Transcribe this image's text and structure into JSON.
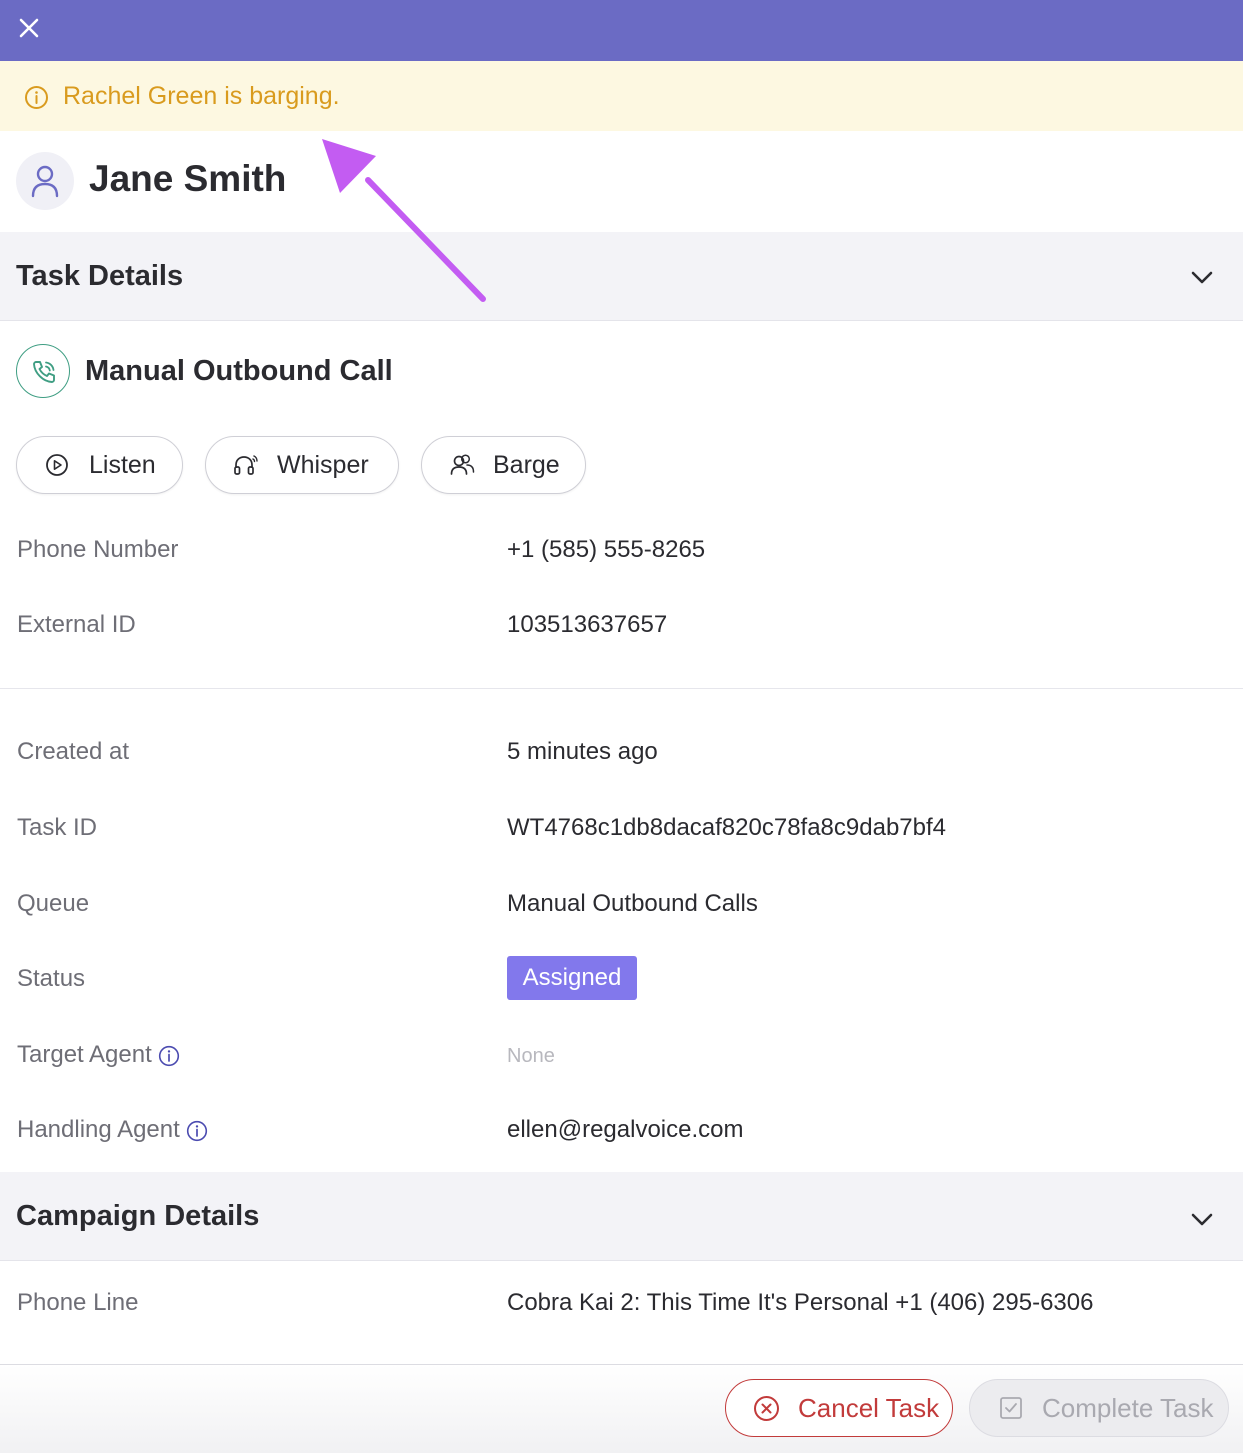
{
  "banner": {
    "text": "Rachel Green is barging."
  },
  "contact": {
    "name": "Jane Smith"
  },
  "task_details": {
    "title": "Task Details",
    "task_type": "Manual Outbound Call",
    "actions": {
      "listen": "Listen",
      "whisper": "Whisper",
      "barge": "Barge"
    },
    "fields": {
      "phone_number": {
        "label": "Phone Number",
        "value": "+1 (585) 555-8265"
      },
      "external_id": {
        "label": "External ID",
        "value": "103513637657"
      },
      "created_at": {
        "label": "Created at",
        "value": "5 minutes ago"
      },
      "task_id": {
        "label": "Task ID",
        "value": "WT4768c1db8dacaf820c78fa8c9dab7bf4"
      },
      "queue": {
        "label": "Queue",
        "value": "Manual Outbound Calls"
      },
      "status": {
        "label": "Status",
        "value": "Assigned"
      },
      "target_agent": {
        "label": "Target Agent",
        "value": "None"
      },
      "handling_agent": {
        "label": "Handling Agent",
        "value": "ellen@regalvoice.com"
      }
    }
  },
  "campaign_details": {
    "title": "Campaign Details",
    "phone_line": {
      "label": "Phone Line",
      "value": "Cobra Kai 2: This Time It's Personal +1 (406) 295-6306"
    }
  },
  "footer": {
    "cancel_label": "Cancel Task",
    "complete_label": "Complete Task"
  },
  "colors": {
    "topbar": "#6b6bc4",
    "banner_bg": "#fdf8e1",
    "banner_text": "#d99b1e",
    "status_badge": "#8278ec",
    "cancel": "#c23b3b",
    "annotation_arrow": "#c35cf2"
  },
  "icons": {
    "close": "close-icon",
    "banner": "info-circle-icon",
    "avatar": "user-icon",
    "task": "phone-call-icon",
    "listen": "play-circle-icon",
    "whisper": "headset-icon",
    "barge": "users-icon",
    "collapse": "chevron-down-icon",
    "cancel": "x-circle-icon",
    "complete": "checkbox-icon"
  }
}
